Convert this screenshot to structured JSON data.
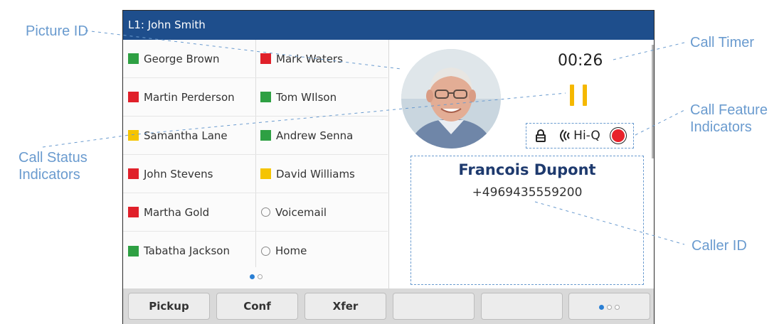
{
  "callouts": {
    "picture_id": "Picture ID",
    "call_timer": "Call Timer",
    "call_feature_line1": "Call Feature",
    "call_feature_line2": "Indicators",
    "call_status_line1": "Call Status",
    "call_status_line2": "Indicators",
    "caller_id": "Caller ID"
  },
  "screen": {
    "title": "L1: John Smith",
    "contacts_col1": [
      {
        "name": "George Brown",
        "status": "green"
      },
      {
        "name": "Martin Perderson",
        "status": "red"
      },
      {
        "name": "Samantha Lane",
        "status": "yellow"
      },
      {
        "name": "John Stevens",
        "status": "red"
      },
      {
        "name": "Martha Gold",
        "status": "red"
      },
      {
        "name": "Tabatha Jackson",
        "status": "green"
      }
    ],
    "contacts_col2": [
      {
        "name": "Mark Waters",
        "status": "red"
      },
      {
        "name": "Tom WIlson",
        "status": "green"
      },
      {
        "name": "Andrew Senna",
        "status": "green"
      },
      {
        "name": "David Williams",
        "status": "yellow"
      },
      {
        "name": "Voicemail",
        "status": "none"
      },
      {
        "name": "Home",
        "status": "none"
      }
    ],
    "status_colors": {
      "green": "#2ea043",
      "red": "#e0202a",
      "yellow": "#f5c400"
    },
    "call": {
      "timer": "00:26",
      "hd_label": "Hi-Q",
      "caller_name": "Francois Dupont",
      "caller_number": "+4969435559200"
    },
    "softkeys": [
      "Pickup",
      "Conf",
      "Xfer",
      "",
      ""
    ],
    "accent": "#1e4e8c"
  }
}
